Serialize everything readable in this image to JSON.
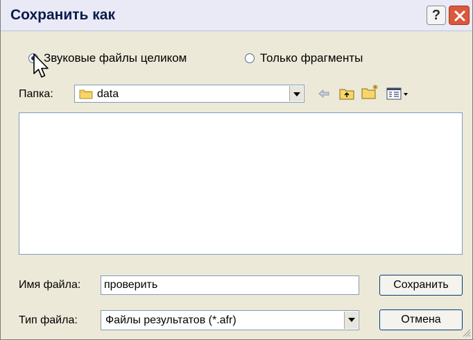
{
  "window": {
    "title": "Сохранить как",
    "help_label": "?"
  },
  "radios": {
    "whole_files": {
      "label": "Звуковые файлы целиком",
      "checked": true
    },
    "fragments_only": {
      "label": "Только фрагменты",
      "checked": false
    }
  },
  "folder": {
    "label": "Папка:",
    "value": "data"
  },
  "toolbar_icons": [
    "back-arrow-icon",
    "up-folder-icon",
    "new-folder-icon",
    "view-menu-icon"
  ],
  "filename": {
    "label": "Имя файла:",
    "value": "проверить"
  },
  "filetype": {
    "label": "Тип файла:",
    "value": "Файлы результатов (*.afr)"
  },
  "buttons": {
    "save": "Сохранить",
    "cancel": "Отмена"
  },
  "colors": {
    "dialog_bg": "#ece9d8",
    "title_bg": "#e9eaf6",
    "close_red": "#d9583e",
    "input_border": "#7f9db9",
    "button_border": "#003c74"
  }
}
